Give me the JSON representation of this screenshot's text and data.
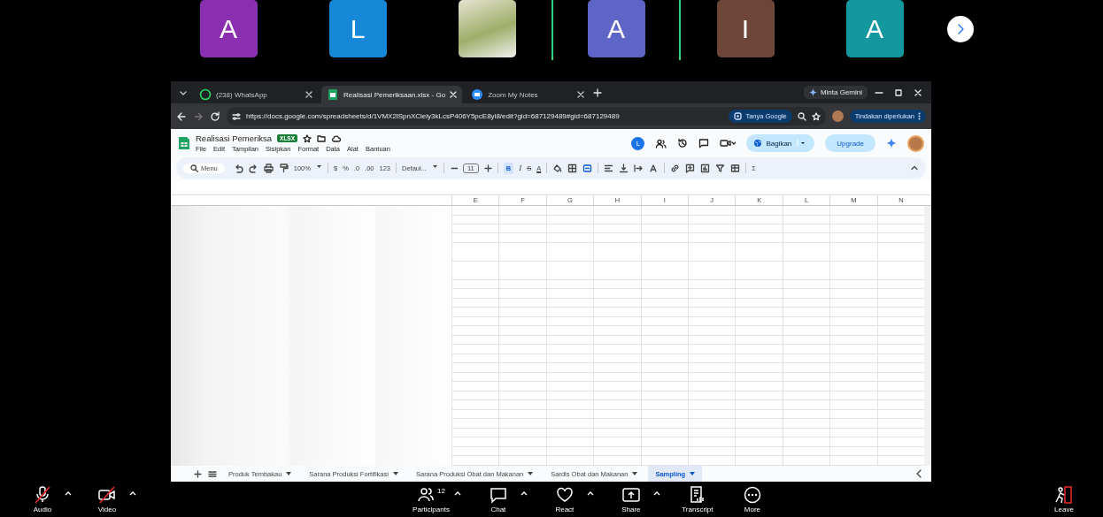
{
  "participants": [
    {
      "kind": "avatar",
      "initial": "A",
      "color": "#8a2fb0",
      "speaking": false
    },
    {
      "kind": "avatar",
      "initial": "L",
      "color": "#1788d8",
      "speaking": false
    },
    {
      "kind": "video",
      "speaking": false
    },
    {
      "kind": "avatar",
      "initial": "A",
      "color": "#5d66c6",
      "speaking": true
    },
    {
      "kind": "avatar",
      "initial": "I",
      "color": "#6e4638",
      "speaking": false
    },
    {
      "kind": "avatar",
      "initial": "A",
      "color": "#14979e",
      "speaking": false
    }
  ],
  "browser": {
    "tabs": [
      {
        "kind": "whatsapp",
        "label": "(238) WhatsApp",
        "selected": false
      },
      {
        "kind": "sheets",
        "label": "Realisasi Pemeriksaan.xlsx - Go",
        "selected": true
      },
      {
        "kind": "zoom",
        "label": "Zoom My Notes",
        "selected": false
      }
    ],
    "gemini": "Minta Gemini",
    "url": "https://docs.google.com/spreadsheets/d/1VMX2lSpnXCieiy3kLcsP406Y5pcE8yl8/edit?gid=687129489#gid=687129489",
    "lens": "Tanya Google",
    "action": "Tindakan diperlukan"
  },
  "sheet": {
    "title": "Realisasi Pemeriksa",
    "badge": "XLSX",
    "menu": [
      "File",
      "Edit",
      "Tampilan",
      "Sisipkan",
      "Format",
      "Data",
      "Alat",
      "Bantuan"
    ],
    "user_initial": "L",
    "share": "Bagikan",
    "upgrade": "Upgrade",
    "toolbar": {
      "menu": "Menu",
      "zoom": "100%",
      "currency": "$",
      "percent": "%",
      "dec_less": ".0",
      "dec_more": ".00",
      "number_format": "123",
      "font": "Defaul...",
      "font_size": "11",
      "bold": {
        "label": "B",
        "on": true
      },
      "italic": "I",
      "strike": "S",
      "text_color": "A",
      "functions": "Σ"
    },
    "columns": [
      "E",
      "F",
      "G",
      "H",
      "I",
      "J",
      "K",
      "L",
      "M",
      "N"
    ],
    "sheet_tabs": [
      {
        "label": "Produk Tembakau",
        "selected": false
      },
      {
        "label": "Sarana Produksi Fortifikasi",
        "selected": false
      },
      {
        "label": "Sarana Produksi Obat dan Makanan",
        "selected": false
      },
      {
        "label": "Sardis Obat dan Makanan",
        "selected": false
      },
      {
        "label": "Sampling",
        "selected": true
      }
    ]
  },
  "controls": [
    {
      "kind": "audio",
      "label": "Audio",
      "muted": true,
      "caret": true
    },
    {
      "kind": "video",
      "label": "Video",
      "muted": true,
      "caret": true
    },
    {
      "kind": "participants",
      "label": "Participants",
      "count": "12",
      "caret": true
    },
    {
      "kind": "chat",
      "label": "Chat",
      "caret": true
    },
    {
      "kind": "react",
      "label": "React",
      "caret": true
    },
    {
      "kind": "share",
      "label": "Share",
      "caret": true
    },
    {
      "kind": "transcript",
      "label": "Transcript",
      "caret": false
    },
    {
      "kind": "more",
      "label": "More",
      "caret": false
    },
    {
      "kind": "leave",
      "label": "Leave",
      "caret": false
    }
  ]
}
